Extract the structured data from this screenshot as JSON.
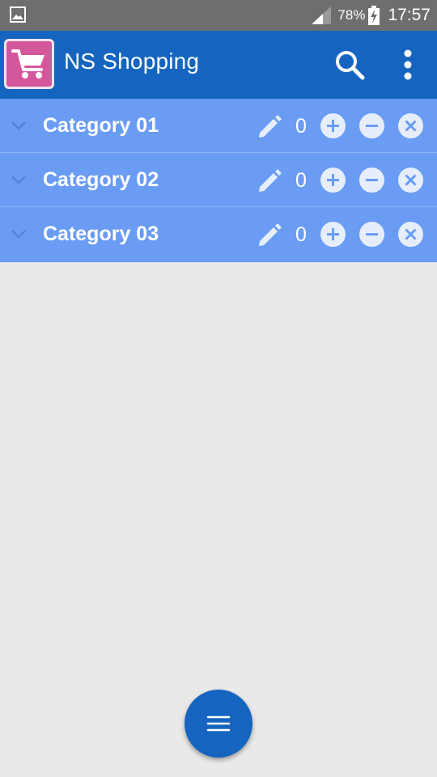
{
  "status_bar": {
    "battery_percent": "78%",
    "time": "17:57",
    "icons": [
      "image-icon",
      "signal-icon",
      "battery-charging-icon"
    ]
  },
  "app_bar": {
    "title": "NS Shopping",
    "logo_icon": "shopping-cart-icon",
    "actions": [
      "search-icon",
      "more-vert-icon"
    ]
  },
  "categories": [
    {
      "name": "Category 01",
      "count": "0"
    },
    {
      "name": "Category 02",
      "count": "0"
    },
    {
      "name": "Category 03",
      "count": "0"
    }
  ],
  "fab": {
    "icon": "menu-icon"
  },
  "colors": {
    "status_bar": "#6e6e6e",
    "app_bar": "#1565c0",
    "row_background": "#6a9cf4",
    "screen_background": "#e9e9e9",
    "logo_background": "#d4569b",
    "fab": "#1565c0"
  }
}
